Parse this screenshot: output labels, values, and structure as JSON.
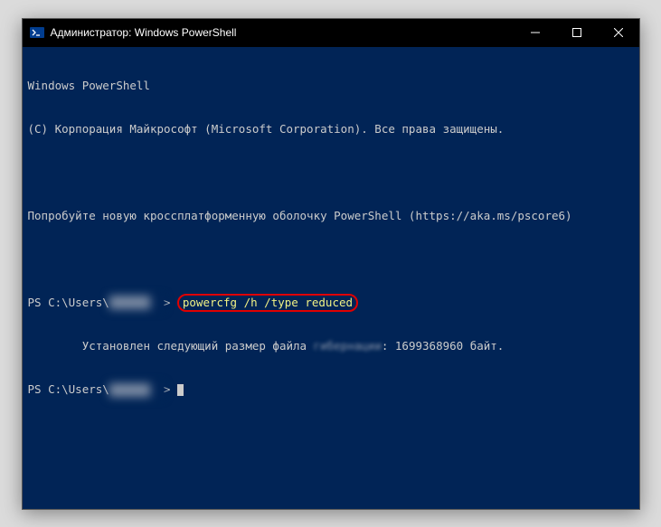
{
  "window": {
    "title": "Администратор: Windows PowerShell"
  },
  "terminal": {
    "header1": "Windows PowerShell",
    "header2": "(C) Корпорация Майкрософт (Microsoft Corporation). Все права защищены.",
    "promo": "Попробуйте новую кроссплатформенную оболочку PowerShell (https://aka.ms/pscore6)",
    "prompt_prefix": "PS C:\\Users\\",
    "prompt_suffix": "> ",
    "redacted_user": "██████",
    "command": "powercfg /h /type reduced",
    "output_indent": "        ",
    "output_pre": "Установлен следующий размер файла ",
    "output_smudge": "гибернации",
    "output_post": ": 1699368960 байт."
  }
}
